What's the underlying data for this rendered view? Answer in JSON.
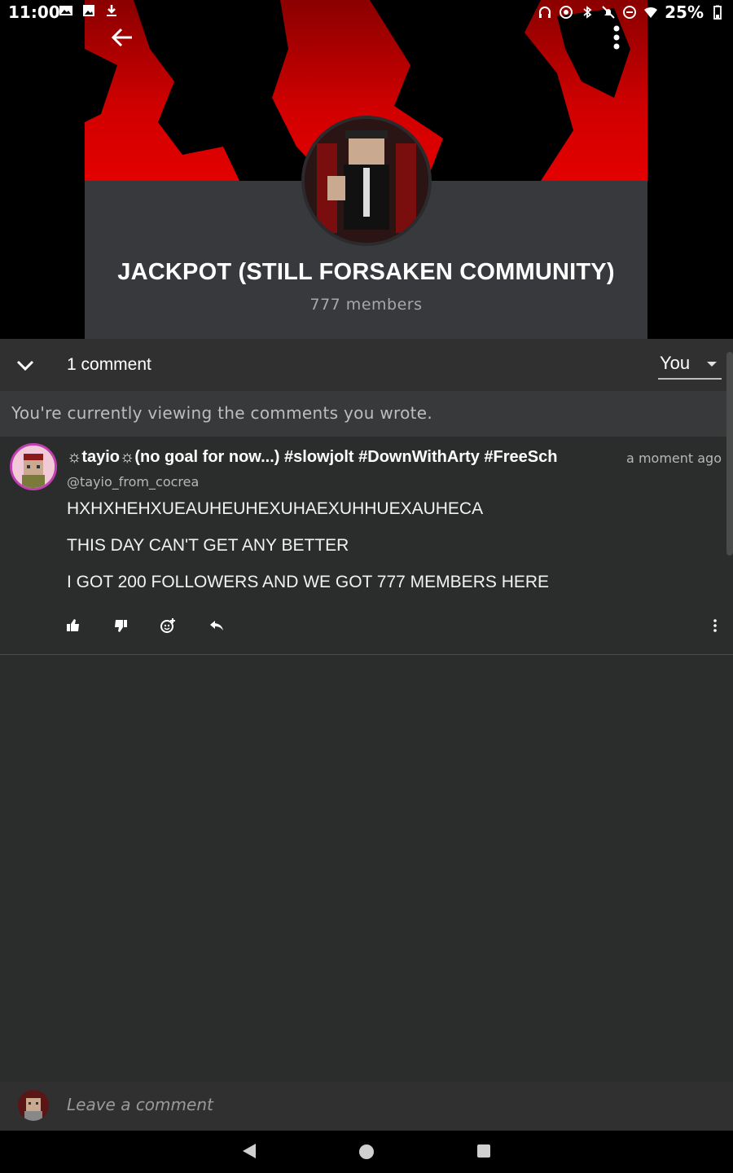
{
  "status_bar": {
    "time": "11:00",
    "battery": "25%",
    "left_icons": [
      "photo-icon",
      "image-icon",
      "download-icon"
    ],
    "right_icons": [
      "headphones-icon",
      "sync-icon",
      "bluetooth-icon",
      "notifications-off-icon",
      "do-not-disturb-icon",
      "wifi-icon",
      "battery-icon"
    ]
  },
  "community": {
    "title": "JACKPOT (STILL FORSAKEN COMMUNITY)",
    "members": "777 members",
    "banner_color": "#d10000",
    "panel_color": "#38393d"
  },
  "comments_header": {
    "count_label": "1 comment",
    "filter_value": "You",
    "viewing_note": "You're currently viewing the comments you wrote."
  },
  "comment": {
    "author": "☼tayio☼(no goal for now...) #slowjolt #DownWithArty #FreeSch",
    "handle": "@tayio_from_cocrea",
    "time": "a moment ago",
    "lines": [
      "HXHXHEHXUEAUHEUHEXUHAEXUHHUEXAUHECA",
      "THIS DAY CAN'T GET ANY BETTER",
      "I GOT 200 FOLLOWERS AND WE GOT 777 MEMBERS HERE"
    ]
  },
  "input": {
    "placeholder": "Leave a comment"
  },
  "colors": {
    "background": "#2b2c2c",
    "accent_red": "#e30000",
    "avatar_ring": "#c03fb0"
  }
}
